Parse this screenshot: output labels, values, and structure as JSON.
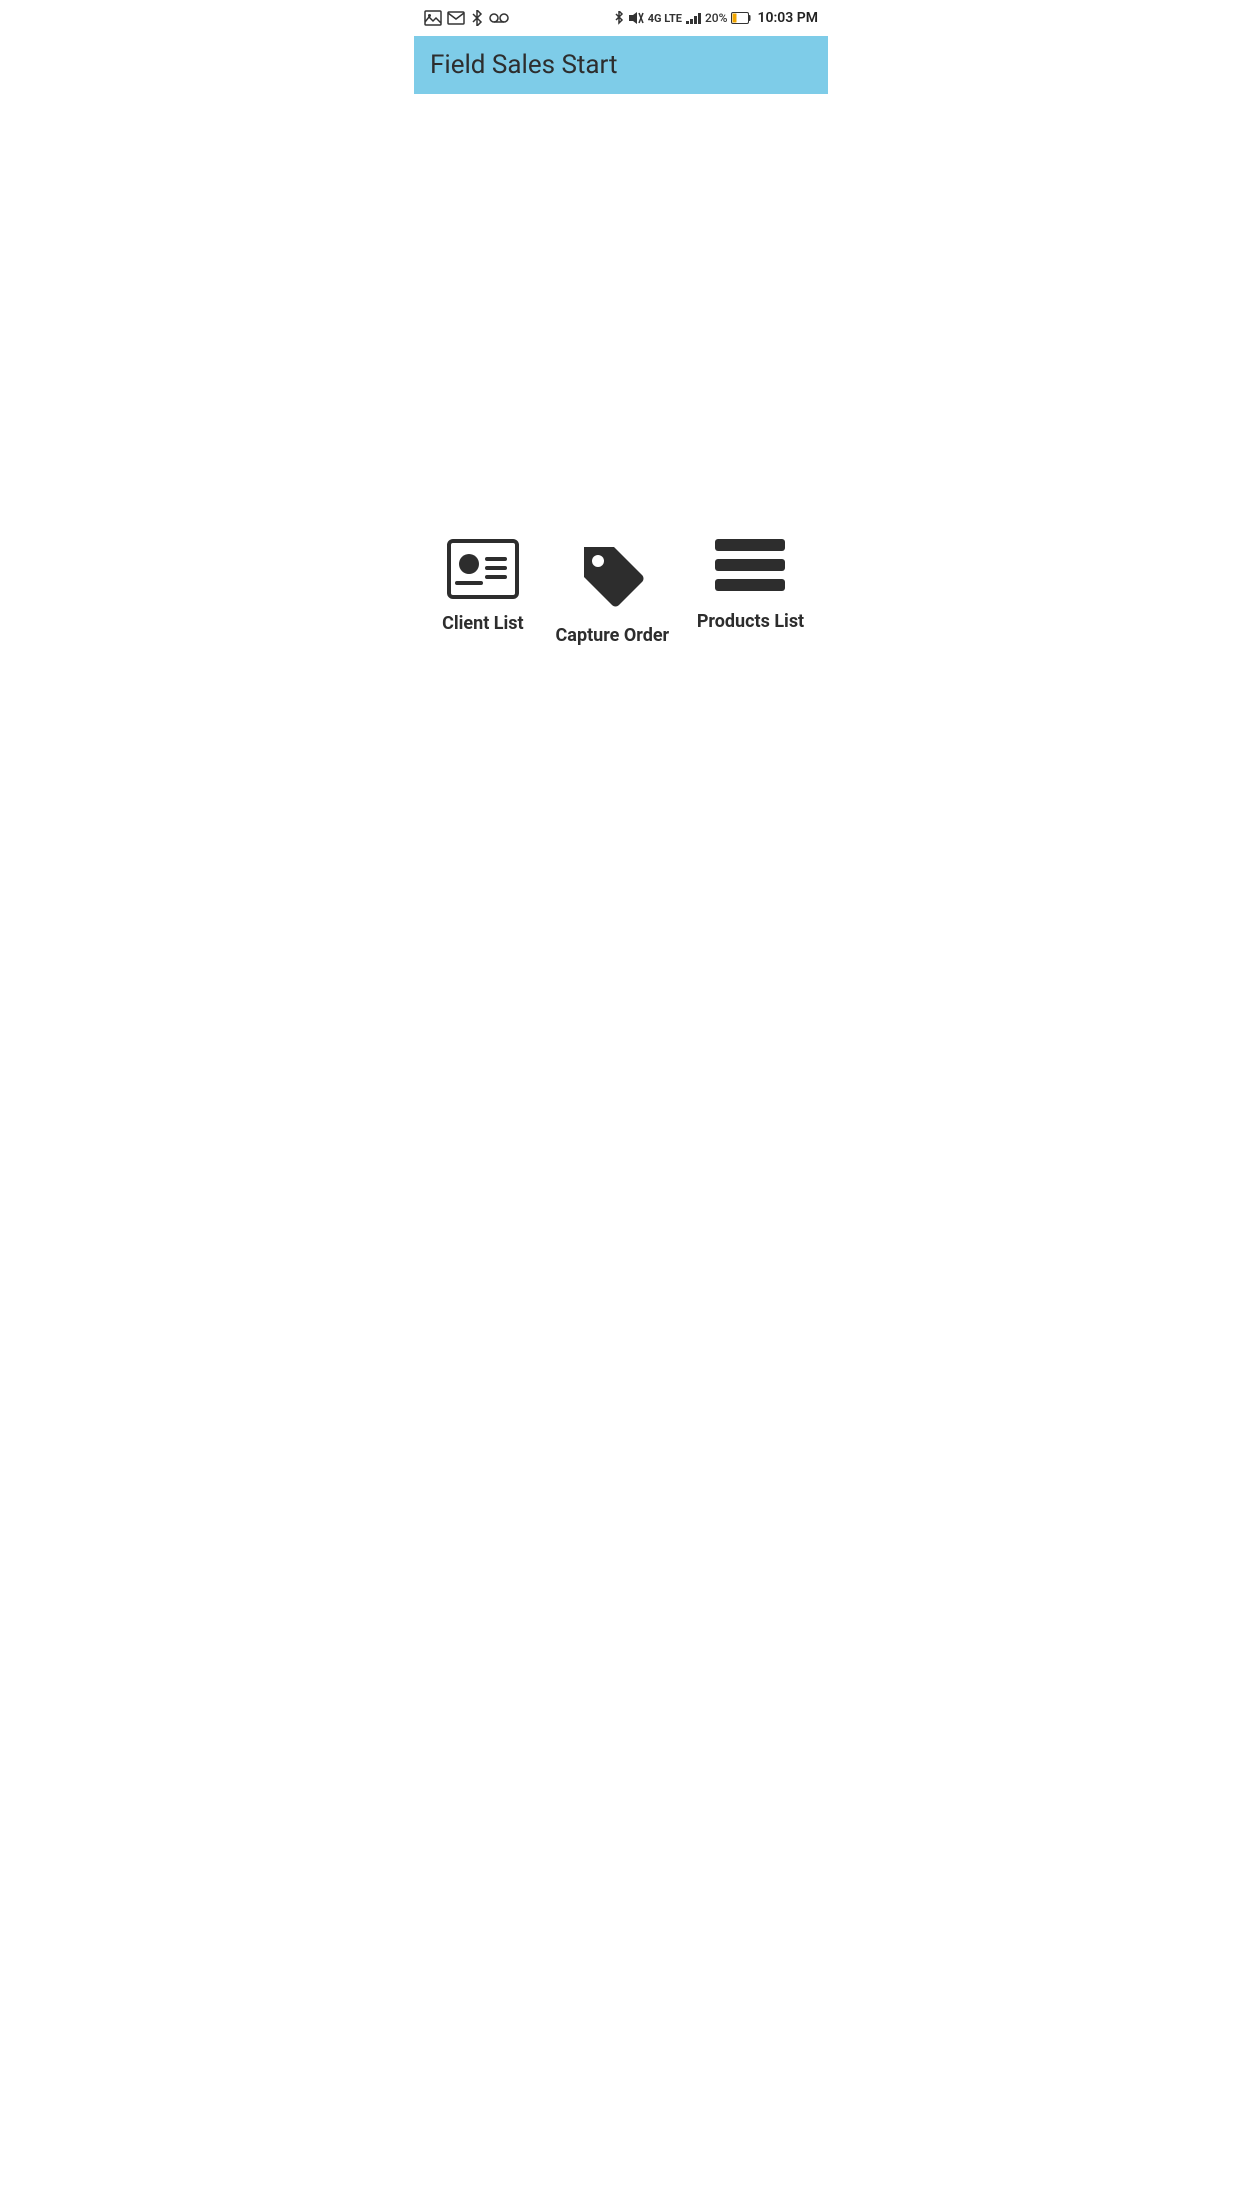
{
  "status_bar": {
    "time": "10:03 PM",
    "battery_percent": "20%",
    "network": "4G LTE"
  },
  "header": {
    "title": "Field Sales Start"
  },
  "menu": {
    "items": [
      {
        "id": "client-list",
        "label": "Client List",
        "icon": "id-card-icon"
      },
      {
        "id": "capture-order",
        "label": "Capture Order",
        "icon": "tag-icon"
      },
      {
        "id": "products-list",
        "label": "Products List",
        "icon": "list-icon"
      }
    ]
  }
}
